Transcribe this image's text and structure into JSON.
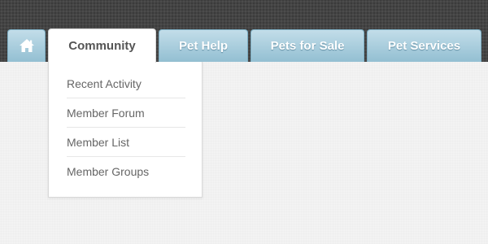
{
  "nav": {
    "home_icon": "home-icon",
    "tabs": [
      {
        "label": "Community",
        "active": true
      },
      {
        "label": "Pet Help",
        "active": false
      },
      {
        "label": "Pets for Sale",
        "active": false
      },
      {
        "label": "Pet Services",
        "active": false
      }
    ]
  },
  "dropdown": {
    "items": [
      {
        "label": "Recent Activity"
      },
      {
        "label": "Member Forum"
      },
      {
        "label": "Member List"
      },
      {
        "label": "Member Groups"
      }
    ]
  },
  "colors": {
    "header_background": "#444444",
    "tab_blue": "#a9cfdf",
    "active_tab": "#ffffff",
    "page_background": "#f2f2f2",
    "menu_text": "#666666"
  }
}
